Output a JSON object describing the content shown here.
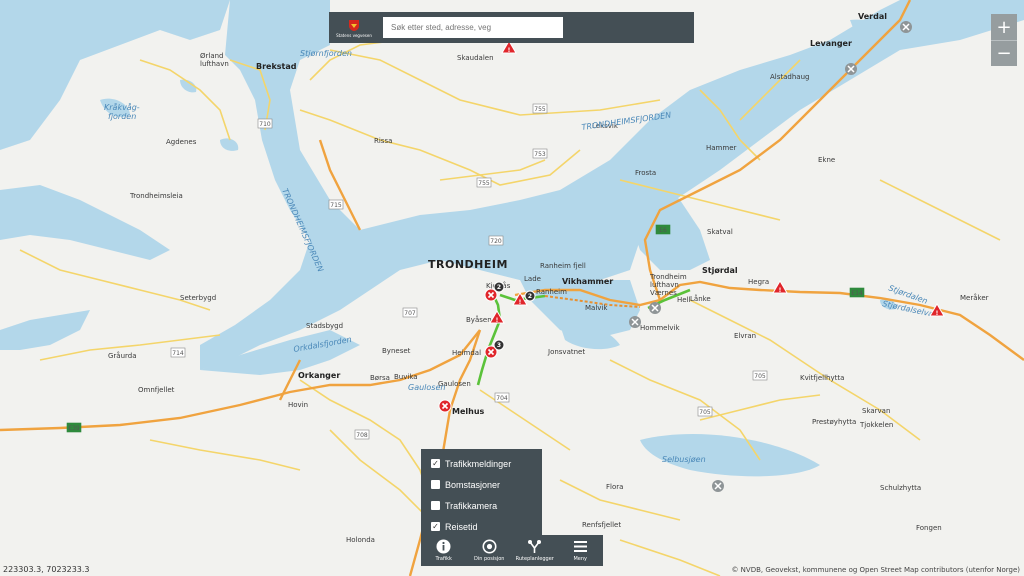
{
  "header": {
    "logo_text": "Statens vegvesen",
    "search_placeholder": "Søk etter sted, adresse, veg"
  },
  "zoom": {
    "in_label": "+",
    "out_label": "−"
  },
  "layers": [
    {
      "label": "Trafikkmeldinger",
      "checked": true
    },
    {
      "label": "Bomstasjoner",
      "checked": false
    },
    {
      "label": "Trafikkamera",
      "checked": false
    },
    {
      "label": "Reisetid",
      "checked": true
    }
  ],
  "toolbar": [
    {
      "label": "Trafikk",
      "icon": "info-icon"
    },
    {
      "label": "Din posisjon",
      "icon": "location-icon"
    },
    {
      "label": "Ruteplanlegger",
      "icon": "route-icon"
    },
    {
      "label": "Meny",
      "icon": "menu-icon"
    }
  ],
  "map": {
    "cities": [
      "TRONDHEIM"
    ],
    "towns": [
      "Brekstad",
      "Orkanger",
      "Melhus",
      "Stjørdal",
      "Levanger",
      "Verdal",
      "Vikhammer"
    ],
    "places": [
      "Skaudalen",
      "Rissa",
      "Agdenes",
      "Trondheim lufthavn Værnes",
      "Ørland lufthavn",
      "Hell",
      "Lånke",
      "Hommelvik",
      "Malvik",
      "Byåsen",
      "Heimdal",
      "Ranheim",
      "Lade",
      "Børsa",
      "Buvika",
      "Byneset",
      "Gråurda",
      "Omnfjellet",
      "Frosta",
      "Alstadhaug",
      "Skarvan",
      "Tjokkelen",
      "Fongen",
      "Renfsfjellet",
      "Holonda",
      "Flora",
      "Ekne",
      "Kvitfjellhytta",
      "Prestøyhytta",
      "Schulzhytta",
      "Hammer",
      "Meråker",
      "Leksvik",
      "Stadsbygd",
      "Jonsvatnet",
      "Hegra",
      "Elvran",
      "Skatval",
      "Seterbygd",
      "Gaulosen",
      "Ranheim fjell",
      "Kjelsås",
      "Trondheimsleia",
      "Hovin"
    ],
    "waters": [
      "Stjørnfjorden",
      "Kråkvåg-fjorden",
      "TRONDHEIMSFJORDEN",
      "TRONDHEIMSFJORDEN",
      "Orkdalsfjorden",
      "Selbusjøen",
      "Stjørdalselva",
      "Stjørdalen",
      "Gaulosen"
    ],
    "road_numbers": [
      "710",
      "715",
      "755",
      "755",
      "753",
      "720",
      "E14",
      "E6",
      "E39",
      "707",
      "714",
      "705",
      "704",
      "708",
      "705"
    ],
    "events": [
      {
        "type": "closed",
        "label": ""
      },
      {
        "type": "warning",
        "label": ""
      },
      {
        "type": "count",
        "label": "2"
      },
      {
        "type": "count",
        "label": "2"
      },
      {
        "type": "count",
        "label": "3"
      }
    ]
  },
  "coordinates": "223303.3, 7023233.3",
  "attribution": "© NVDB, Geovekst, kommunene og Open Street Map contributors (utenfor Norge)",
  "colors": {
    "panel": "#444f55",
    "water": "#b3d7ea",
    "land": "#f2f2ef",
    "road_major": "#f0a33f",
    "road_minor": "#f4d56a",
    "traffic_ok": "#5bc23a",
    "incident": "#e0262b"
  }
}
